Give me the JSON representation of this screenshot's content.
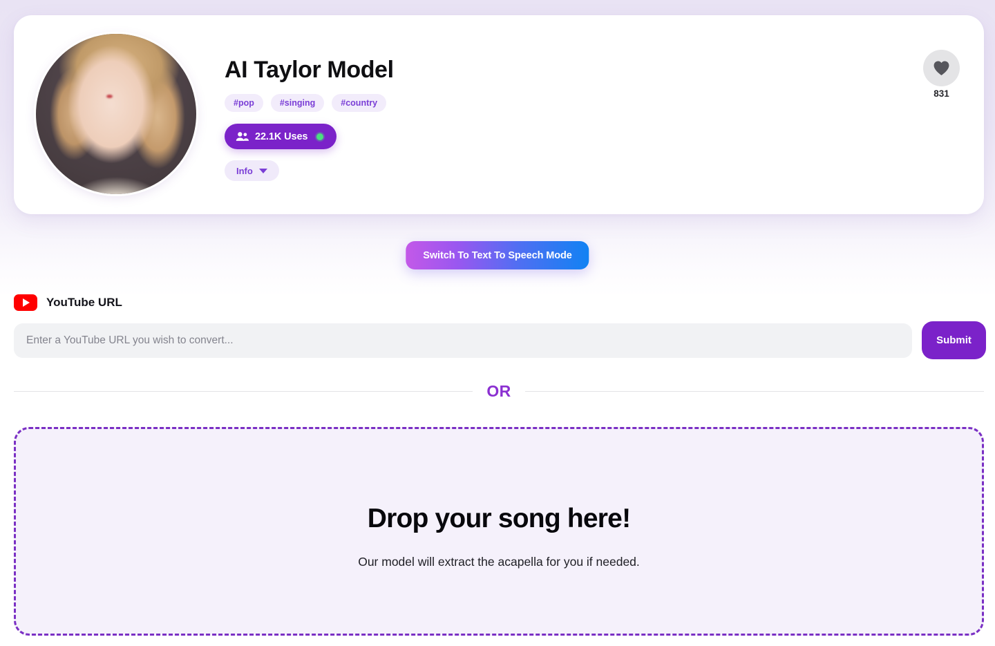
{
  "profile": {
    "name": "AI Taylor Model",
    "avatar_alt": "ai-generated-portrait-of-blonde-woman",
    "tags": [
      "#pop",
      "#singing",
      "#country"
    ],
    "uses": {
      "icon": "people-icon",
      "label": "22.1K Uses",
      "status_dot_color": "#4ade80"
    },
    "info": {
      "label": "Info",
      "icon": "chevron-down-icon"
    },
    "likes": {
      "icon": "heart-icon",
      "count": "831"
    }
  },
  "mode_switch": {
    "label": "Switch To Text To Speech Mode",
    "gradient_from": "#c359e8",
    "gradient_to": "#1182f3"
  },
  "youtube": {
    "icon": "youtube-icon",
    "label": "YouTube URL",
    "input_value": "",
    "placeholder": "Enter a YouTube URL you wish to convert...",
    "submit_label": "Submit"
  },
  "divider": {
    "text": "OR"
  },
  "dropzone": {
    "title": "Drop your song here!",
    "subtitle": "Our model will extract the acapella for you if needed.",
    "border_color": "#7a2fc4",
    "fill_color": "#f5f1fb"
  },
  "theme": {
    "accent_purple": "#7b22c9",
    "tag_text": "#7a3ed6",
    "page_background": "#ece7f6"
  }
}
